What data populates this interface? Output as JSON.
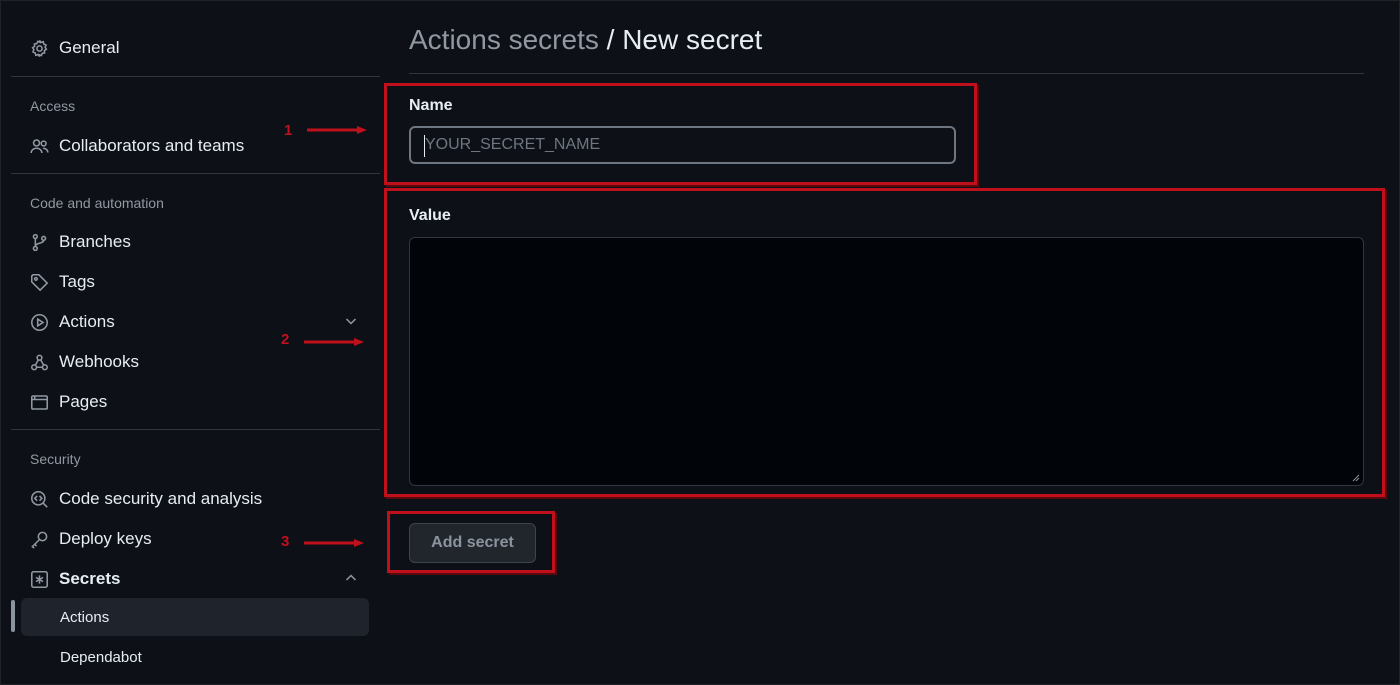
{
  "sidebar": {
    "general": "General",
    "sections": {
      "access": "Access",
      "code_automation": "Code and automation",
      "security": "Security"
    },
    "items": {
      "collaborators": "Collaborators and teams",
      "branches": "Branches",
      "tags": "Tags",
      "actions": "Actions",
      "webhooks": "Webhooks",
      "pages": "Pages",
      "code_security": "Code security and analysis",
      "deploy_keys": "Deploy keys",
      "secrets": "Secrets"
    },
    "secrets_sub": {
      "actions": "Actions",
      "dependabot": "Dependabot"
    }
  },
  "main": {
    "breadcrumb": "Actions secrets",
    "separator": " / ",
    "title": "New secret",
    "name_label": "Name",
    "name_placeholder": "YOUR_SECRET_NAME",
    "value_label": "Value",
    "submit": "Add secret"
  },
  "annotations": {
    "step1": "1",
    "step2": "2",
    "step3": "3"
  },
  "colors": {
    "background": "#0d1117",
    "annotation": "#c0101c",
    "muted_text": "#9198a1"
  },
  "icons": [
    "gear-icon",
    "people-icon",
    "git-branch-icon",
    "tag-icon",
    "play-icon",
    "webhook-icon",
    "browser-icon",
    "codescan-icon",
    "key-icon",
    "key-asterisk-icon",
    "chevron-down-icon",
    "chevron-up-icon"
  ]
}
